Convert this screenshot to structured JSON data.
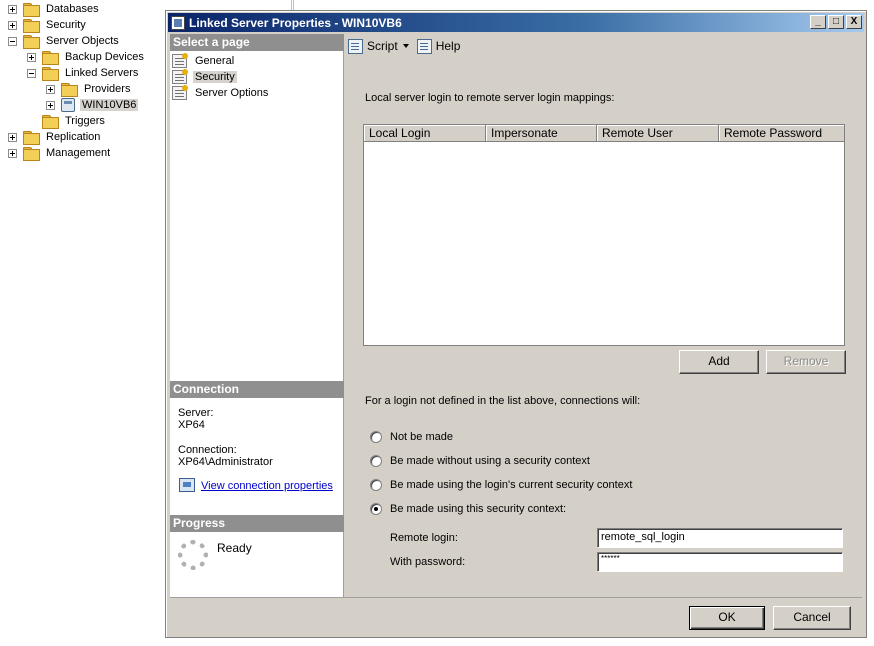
{
  "tree": {
    "items": [
      {
        "label": "Databases"
      },
      {
        "label": "Security"
      },
      {
        "label": "Server Objects"
      },
      {
        "label": "Backup Devices"
      },
      {
        "label": "Linked Servers"
      },
      {
        "label": "Providers"
      },
      {
        "label": "WIN10VB6"
      },
      {
        "label": "Triggers"
      },
      {
        "label": "Replication"
      },
      {
        "label": "Management"
      }
    ]
  },
  "dialog": {
    "title": "Linked Server Properties - WIN10VB6",
    "window_buttons": {
      "minimize": "_",
      "maximize": "□",
      "close": "X"
    },
    "select_page_header": "Select a page",
    "pages": [
      {
        "label": "General"
      },
      {
        "label": "Security"
      },
      {
        "label": "Server Options"
      }
    ],
    "connection": {
      "header": "Connection",
      "server_label": "Server:",
      "server_value": "XP64",
      "connection_label": "Connection:",
      "connection_value": "XP64\\Administrator",
      "view_link": "View connection properties"
    },
    "progress": {
      "header": "Progress",
      "status": "Ready"
    },
    "toolbar": {
      "script_label": "Script",
      "help_label": "Help"
    },
    "security": {
      "mappings_label": "Local server login to remote server login mappings:",
      "columns": [
        "Local Login",
        "Impersonate",
        "Remote User",
        "Remote Password"
      ],
      "add_button": "Add",
      "remove_button": "Remove",
      "not_defined_label": "For a login not defined in the list above, connections will:",
      "options": [
        {
          "label": "Not be made",
          "checked": false
        },
        {
          "label": "Be made without using a security context",
          "checked": false
        },
        {
          "label": "Be made using the login's current security context",
          "checked": false
        },
        {
          "label": "Be made using this security context:",
          "checked": true
        }
      ],
      "remote_login_label": "Remote login:",
      "remote_login_value": "remote_sql_login",
      "password_label": "With password:",
      "password_value": "******"
    },
    "ok_button": "OK",
    "cancel_button": "Cancel"
  }
}
